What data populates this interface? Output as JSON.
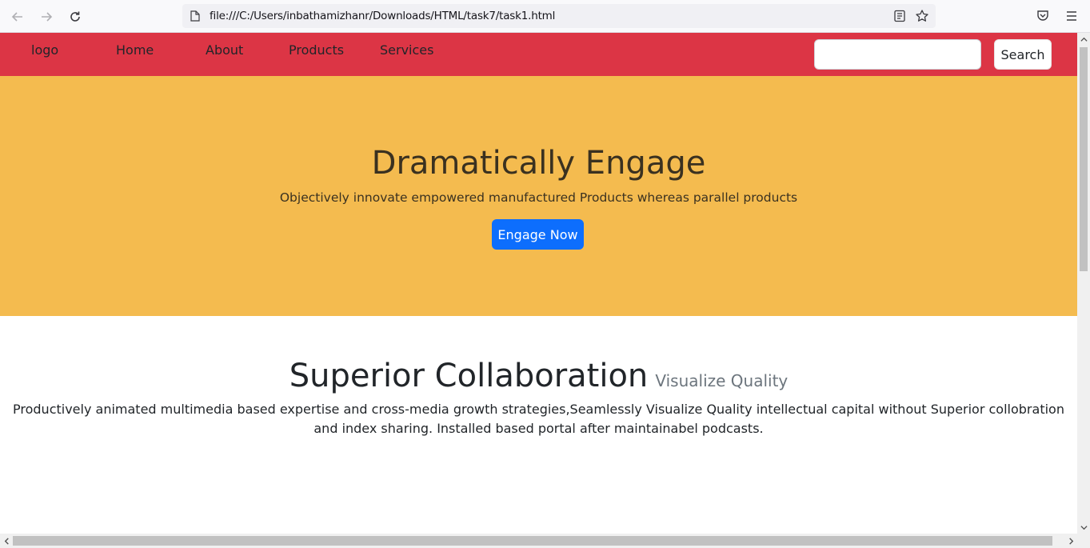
{
  "browser": {
    "url": "file:///C:/Users/inbathamizhanr/Downloads/HTML/task7/task1.html",
    "icons": [
      "back-arrow-icon",
      "forward-arrow-icon",
      "reload-icon",
      "page-icon",
      "reader-view-icon",
      "bookmark-star-icon",
      "pocket-icon",
      "menu-icon"
    ]
  },
  "navbar": {
    "background": "#dc3545",
    "logo": "logo",
    "links": [
      "Home",
      "About",
      "Products",
      "Services"
    ],
    "search": {
      "placeholder": "",
      "button_label": "Search"
    }
  },
  "hero": {
    "background": "#f4bb4f",
    "title": "Dramatically Engage",
    "subtitle": "Objectively innovate empowered manufactured Products whereas parallel products",
    "button_label": "Engage Now",
    "button_color": "#0d6efd"
  },
  "section": {
    "title": "Superior Collaboration",
    "subtitle": "Visualize Quality",
    "body": "Productively animated multimedia based expertise and cross-media growth strategies,Seamlessly Visualize Quality intellectual capital without Superior collobration and index sharing. Installed based portal after maintainabel podcasts."
  }
}
